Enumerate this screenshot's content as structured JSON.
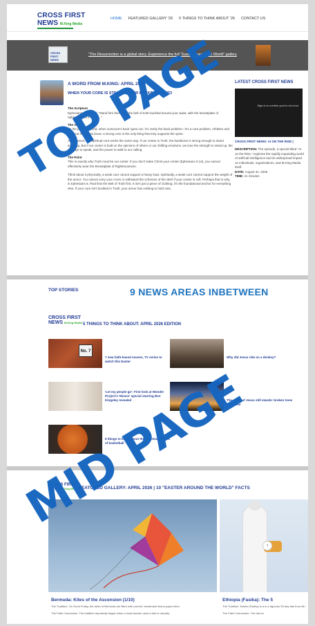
{
  "brand": {
    "logo_line1": "CROSS FIRST",
    "logo_line2": "NEWS",
    "logo_tag": "M.King Media",
    "accent": "#1f3a93",
    "link_blue": "#1e73be",
    "stamp_blue": "#1565c0"
  },
  "nav": {
    "items": [
      {
        "label": "HOME",
        "active": true
      },
      {
        "label": "FEATURED GALLERY '26",
        "active": false
      },
      {
        "label": "5 THINGS TO THINK ABOUT '26",
        "active": false
      },
      {
        "label": "CONTACT US",
        "active": false
      }
    ]
  },
  "banner": {
    "thumb_text": "CROSS FIRST NEWS",
    "link_text": "\"The Resurrection is a global story. Experience the full \"Easter Around the World\" gallery"
  },
  "article": {
    "title": "A WORD FROM M.KING: APRIL 2026",
    "subtitle": "WHEN YOUR CORE IS STRONG, YOUR BACKBONE IS TO",
    "sections": [
      {
        "heading": "The Scripture",
        "text": "Ephesians 6:14 (NIV) \"Stand firm then, with the belt of truth buckled around your waist, with the breastplate of righteousness in place...\""
      },
      {
        "heading": "The Vibe",
        "text": "\"In the physical world, when someone's back 'goes out,' it's rarely the back problem—it's a core problem. Athletes and physical therapists know: a strong core is the only thing that truly supports the spine."
      },
      {
        "heading": "",
        "text": "As believers, our spiritual core works the same way. If our center is Truth, the backbone is strong enough to stand anything. But if our center is built on the opinions of others or our shifting emotions, we lose the strength to stand up, the courage to speak, and the power to walk in our calling."
      },
      {
        "heading": "The Point",
        "text": "This is exactly why Truth must be our center. If you don't make Christ your center (Ephesians 6:14), you cannot effectively wear the Breastplate of Righteousness."
      },
      {
        "heading": "",
        "text": "Think about it physically, a weak core cannot support a heavy load. Spiritually, a weak core cannot support the weight of the armor. You cannot carry your cross or withstand the schemes of the devil if your center is soft. Perhaps that is why, in Ephesians 6, Paul lists the Belt of Truth first. It isn't just a piece of clothing; it's the foundational anchor for everything else. If your core isn't buckled in Truth, your armor has nothing to hold onto."
      }
    ]
  },
  "sidebar": {
    "title": "LATEST CROSS FIRST NEWS",
    "video_text": "Sign in to confirm you're not a bot",
    "caption": "CROSS FIRST NEWS: AI ON THE RISE |",
    "description_label": "DESCRIPTION:",
    "description": "The episode, a special titled \"AI on the Rise,\" explores the rapidly expanding world of artificial intelligence and its widespread impact on individuals, organizations, and M.King Media itself.",
    "date_label": "DATE:",
    "date": "August 31, 2025",
    "time_label": "TIME:",
    "time": "21 minutes"
  },
  "middle": {
    "top_stories": "TOP STORIES",
    "big_label": "9 NEWS AREAS INBETWEEN",
    "section_title": "5 THINGS TO THINK ABOUT: APRIL 2026 EDITION",
    "items": [
      {
        "title": "7 new faith-based movies, TV series to watch this Easter",
        "tile": "No. 7"
      },
      {
        "title": "Why did Jesus ride on a donkey?"
      },
      {
        "title": "'Let my people go': First look at Wonder Project's 'Moses' special starring Ben Kingsley revealed"
      },
      {
        "title": "The cross of Jesus still stands: broken trees book tour"
      },
      {
        "title": "6 things to know about the Christian origins of basketball"
      }
    ]
  },
  "gallery": {
    "title": "FEATURED GALLERY: APRIL 2026 | 10 \"EASTER AROUND THE WORLD\" FACTS",
    "next_symbol": "›",
    "slides": [
      {
        "caption": "Bermuda: Kites of the Ascension (1/10)",
        "text": "The Tradition: On Good Friday, the skies of Bermuda are filled with colorful, handmade tissue-paper kites.",
        "text2": "The Faith Connection: The tradition reportedly began when a local teacher used a kite to visually..."
      },
      {
        "caption": "Ethiopia (Fasika): The 5",
        "text": "The Tradition: Easter (Fasika) is a in a rigorous 55-day fast from all r",
        "text2": "The Faith Connection: The fast ex"
      }
    ]
  },
  "overlays": {
    "top": "TOP PAGE",
    "mid": "MID PAGE"
  }
}
